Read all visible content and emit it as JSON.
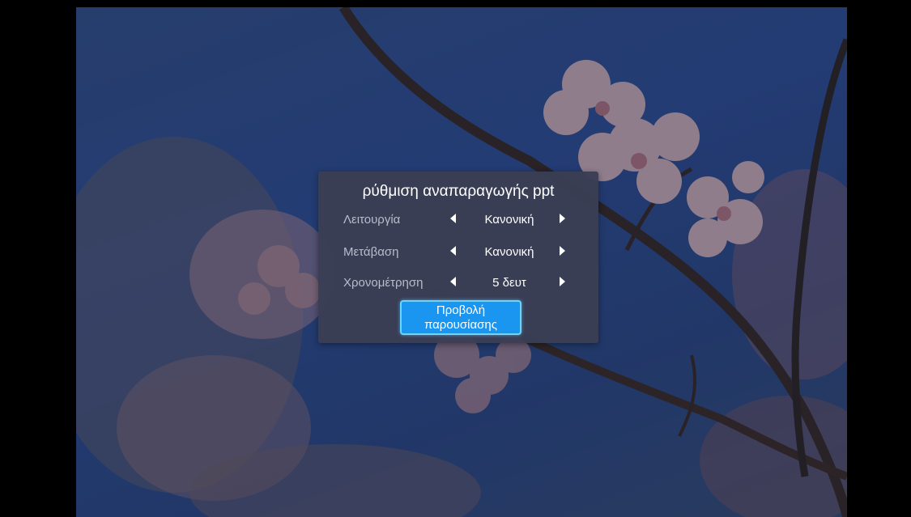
{
  "dialog": {
    "title": "ρύθμιση αναπαραγωγής ppt",
    "rows": [
      {
        "label": "Λειτουργία",
        "value": "Κανονική"
      },
      {
        "label": "Μετάβαση",
        "value": "Κανονική"
      },
      {
        "label": "Χρονομέτρηση",
        "value": "5 δευτ"
      }
    ],
    "start_button": {
      "line1": "Προβολή",
      "line2": "παρουσίασης"
    }
  },
  "colors": {
    "dialog_bg": "#3a3e54",
    "button_bg": "#1a96f0",
    "button_border": "#6ad6ff",
    "label_text": "#b9bccb"
  },
  "icons": {
    "prev": "triangle-left-icon",
    "next": "triangle-right-icon"
  }
}
